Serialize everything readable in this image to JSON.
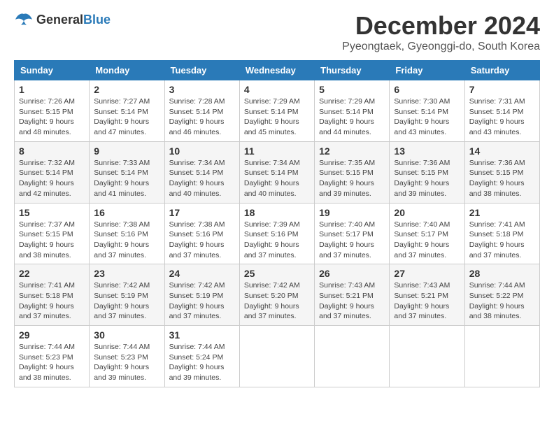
{
  "logo": {
    "text_general": "General",
    "text_blue": "Blue"
  },
  "title": "December 2024",
  "location": "Pyeongtaek, Gyeonggi-do, South Korea",
  "days_of_week": [
    "Sunday",
    "Monday",
    "Tuesday",
    "Wednesday",
    "Thursday",
    "Friday",
    "Saturday"
  ],
  "weeks": [
    [
      {
        "day": "1",
        "sunrise": "7:26 AM",
        "sunset": "5:15 PM",
        "daylight": "9 hours and 48 minutes."
      },
      {
        "day": "2",
        "sunrise": "7:27 AM",
        "sunset": "5:14 PM",
        "daylight": "9 hours and 47 minutes."
      },
      {
        "day": "3",
        "sunrise": "7:28 AM",
        "sunset": "5:14 PM",
        "daylight": "9 hours and 46 minutes."
      },
      {
        "day": "4",
        "sunrise": "7:29 AM",
        "sunset": "5:14 PM",
        "daylight": "9 hours and 45 minutes."
      },
      {
        "day": "5",
        "sunrise": "7:29 AM",
        "sunset": "5:14 PM",
        "daylight": "9 hours and 44 minutes."
      },
      {
        "day": "6",
        "sunrise": "7:30 AM",
        "sunset": "5:14 PM",
        "daylight": "9 hours and 43 minutes."
      },
      {
        "day": "7",
        "sunrise": "7:31 AM",
        "sunset": "5:14 PM",
        "daylight": "9 hours and 43 minutes."
      }
    ],
    [
      {
        "day": "8",
        "sunrise": "7:32 AM",
        "sunset": "5:14 PM",
        "daylight": "9 hours and 42 minutes."
      },
      {
        "day": "9",
        "sunrise": "7:33 AM",
        "sunset": "5:14 PM",
        "daylight": "9 hours and 41 minutes."
      },
      {
        "day": "10",
        "sunrise": "7:34 AM",
        "sunset": "5:14 PM",
        "daylight": "9 hours and 40 minutes."
      },
      {
        "day": "11",
        "sunrise": "7:34 AM",
        "sunset": "5:14 PM",
        "daylight": "9 hours and 40 minutes."
      },
      {
        "day": "12",
        "sunrise": "7:35 AM",
        "sunset": "5:15 PM",
        "daylight": "9 hours and 39 minutes."
      },
      {
        "day": "13",
        "sunrise": "7:36 AM",
        "sunset": "5:15 PM",
        "daylight": "9 hours and 39 minutes."
      },
      {
        "day": "14",
        "sunrise": "7:36 AM",
        "sunset": "5:15 PM",
        "daylight": "9 hours and 38 minutes."
      }
    ],
    [
      {
        "day": "15",
        "sunrise": "7:37 AM",
        "sunset": "5:15 PM",
        "daylight": "9 hours and 38 minutes."
      },
      {
        "day": "16",
        "sunrise": "7:38 AM",
        "sunset": "5:16 PM",
        "daylight": "9 hours and 37 minutes."
      },
      {
        "day": "17",
        "sunrise": "7:38 AM",
        "sunset": "5:16 PM",
        "daylight": "9 hours and 37 minutes."
      },
      {
        "day": "18",
        "sunrise": "7:39 AM",
        "sunset": "5:16 PM",
        "daylight": "9 hours and 37 minutes."
      },
      {
        "day": "19",
        "sunrise": "7:40 AM",
        "sunset": "5:17 PM",
        "daylight": "9 hours and 37 minutes."
      },
      {
        "day": "20",
        "sunrise": "7:40 AM",
        "sunset": "5:17 PM",
        "daylight": "9 hours and 37 minutes."
      },
      {
        "day": "21",
        "sunrise": "7:41 AM",
        "sunset": "5:18 PM",
        "daylight": "9 hours and 37 minutes."
      }
    ],
    [
      {
        "day": "22",
        "sunrise": "7:41 AM",
        "sunset": "5:18 PM",
        "daylight": "9 hours and 37 minutes."
      },
      {
        "day": "23",
        "sunrise": "7:42 AM",
        "sunset": "5:19 PM",
        "daylight": "9 hours and 37 minutes."
      },
      {
        "day": "24",
        "sunrise": "7:42 AM",
        "sunset": "5:19 PM",
        "daylight": "9 hours and 37 minutes."
      },
      {
        "day": "25",
        "sunrise": "7:42 AM",
        "sunset": "5:20 PM",
        "daylight": "9 hours and 37 minutes."
      },
      {
        "day": "26",
        "sunrise": "7:43 AM",
        "sunset": "5:21 PM",
        "daylight": "9 hours and 37 minutes."
      },
      {
        "day": "27",
        "sunrise": "7:43 AM",
        "sunset": "5:21 PM",
        "daylight": "9 hours and 37 minutes."
      },
      {
        "day": "28",
        "sunrise": "7:44 AM",
        "sunset": "5:22 PM",
        "daylight": "9 hours and 38 minutes."
      }
    ],
    [
      {
        "day": "29",
        "sunrise": "7:44 AM",
        "sunset": "5:23 PM",
        "daylight": "9 hours and 38 minutes."
      },
      {
        "day": "30",
        "sunrise": "7:44 AM",
        "sunset": "5:23 PM",
        "daylight": "9 hours and 39 minutes."
      },
      {
        "day": "31",
        "sunrise": "7:44 AM",
        "sunset": "5:24 PM",
        "daylight": "9 hours and 39 minutes."
      },
      null,
      null,
      null,
      null
    ]
  ]
}
